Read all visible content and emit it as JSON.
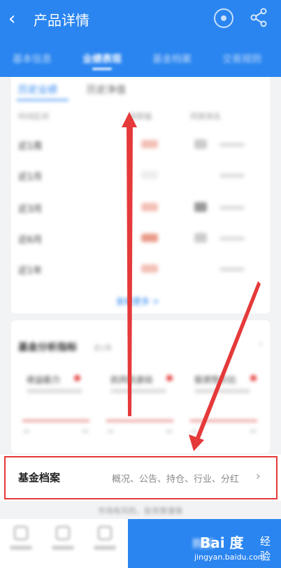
{
  "header": {
    "back_glyph": "‹",
    "title": "产品详情",
    "icons": [
      "back-icon",
      "record-icon",
      "share-icon"
    ],
    "tabs": [
      "基本信息",
      "业绩表现",
      "基金档案",
      "交易规则"
    ],
    "active_tab_index": 1,
    "color": "#2a85f0"
  },
  "performance_card": {
    "subtabs": [
      "历史业绩",
      "历史净值"
    ],
    "columns": [
      "时间区间",
      "涨跌幅",
      "同类排名"
    ],
    "rows": [
      "近1周",
      "近1月",
      "近3月",
      "近6月",
      "近1年"
    ],
    "more_link": "查看更多 >"
  },
  "analysis_card": {
    "title": "基金分析指标",
    "badge": "近1年",
    "metrics": [
      "收益能力",
      "抗风险波动",
      "投资性价比"
    ]
  },
  "archive_row": {
    "label": "基金档案",
    "items": "概况、公告、持仓、行业、分红",
    "chevron": "›",
    "highlight_color": "#e5393a"
  },
  "footer": {
    "notice": "市场有风险，投资需谨慎",
    "bottom_items": [
      "自选",
      "定投",
      "客服"
    ],
    "buy_label": "购买",
    "accent": "#2a85f0"
  },
  "watermark": {
    "brand": "Bai 度",
    "suffix": "经验",
    "url": "jingyan.baidu.com"
  },
  "annotation_color": "#e5393a"
}
